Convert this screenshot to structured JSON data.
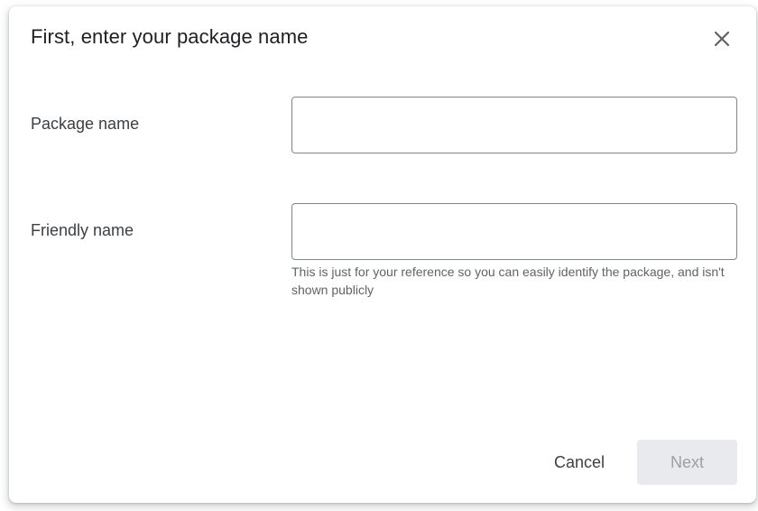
{
  "dialog": {
    "title": "First, enter your package name",
    "close_icon": "close-icon"
  },
  "form": {
    "package_name": {
      "label": "Package name",
      "value": "",
      "placeholder": ""
    },
    "friendly_name": {
      "label": "Friendly name",
      "value": "",
      "placeholder": "",
      "hint": "This is just for your reference so you can easily identify the package, and isn't shown publicly"
    }
  },
  "actions": {
    "cancel_label": "Cancel",
    "next_label": "Next",
    "next_enabled": false
  },
  "colors": {
    "input_border": "#80868b",
    "next_disabled_bg": "#e8eaed",
    "next_disabled_text": "#9aa0a6"
  }
}
